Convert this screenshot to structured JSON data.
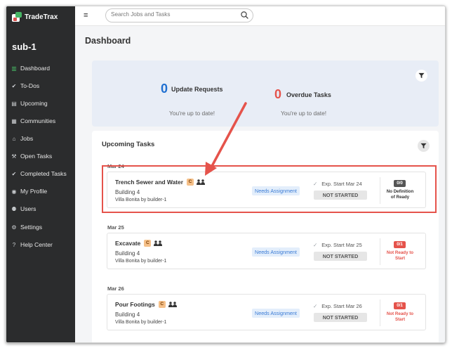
{
  "app": {
    "name": "TradeTrax",
    "org": "sub-1"
  },
  "sidebar": {
    "items": [
      {
        "label": "Dashboard",
        "icon": "dashboard-icon",
        "glyph": "▥",
        "active": true
      },
      {
        "label": "To-Dos",
        "icon": "check-circle-icon",
        "glyph": "✔"
      },
      {
        "label": "Upcoming",
        "icon": "clipboard-icon",
        "glyph": "▤"
      },
      {
        "label": "Communities",
        "icon": "building-icon",
        "glyph": "▦"
      },
      {
        "label": "Jobs",
        "icon": "home-icon",
        "glyph": "⌂"
      },
      {
        "label": "Open Tasks",
        "icon": "wrench-icon",
        "glyph": "⚒"
      },
      {
        "label": "Completed Tasks",
        "icon": "check-circle-icon",
        "glyph": "✔"
      },
      {
        "label": "My Profile",
        "icon": "user-circle-icon",
        "glyph": "◉"
      },
      {
        "label": "Users",
        "icon": "users-icon",
        "glyph": "⚉"
      },
      {
        "label": "Settings",
        "icon": "gear-icon",
        "glyph": "⚙"
      },
      {
        "label": "Help Center",
        "icon": "question-circle-icon",
        "glyph": "?"
      }
    ]
  },
  "header": {
    "search_placeholder": "Search Jobs and Tasks"
  },
  "page": {
    "title": "Dashboard"
  },
  "summary": {
    "update_requests": {
      "count": "0",
      "label": "Update Requests",
      "status": "You're up to date!"
    },
    "overdue_tasks": {
      "count": "0",
      "label": "Overdue Tasks",
      "status": "You're up to date!"
    }
  },
  "upcoming": {
    "title": "Upcoming Tasks",
    "groups": [
      {
        "date": "Mar 24",
        "task": {
          "name": "Trench Sewer and Water",
          "badge": "C",
          "building": "Building 4",
          "community": "Villa Bonita by builder-1",
          "assignment": "Needs Assignment",
          "exp_start": "Exp. Start Mar 24",
          "status": "NOT STARTED",
          "ready_badge": "0/0",
          "ready_text": "No Definition of Ready"
        }
      },
      {
        "date": "Mar 25",
        "task": {
          "name": "Excavate",
          "badge": "C",
          "building": "Building 4",
          "community": "Villa Bonita by builder-1",
          "assignment": "Needs Assignment",
          "exp_start": "Exp. Start Mar 25",
          "status": "NOT STARTED",
          "ready_badge": "0/1",
          "ready_text": "Not Ready to Start"
        }
      },
      {
        "date": "Mar 26",
        "task": {
          "name": "Pour Footings",
          "badge": "C",
          "building": "Building 4",
          "community": "Villa Bonita by builder-1",
          "assignment": "Needs Assignment",
          "exp_start": "Exp. Start Mar 26",
          "status": "NOT STARTED",
          "ready_badge": "0/1",
          "ready_text": "Not Ready to Start"
        }
      }
    ]
  },
  "colors": {
    "sidebar_bg": "#2b2c2d",
    "accent_blue": "#1f6fd1",
    "overdue_red": "#e5534b",
    "not_ready_red": "#e5534b",
    "no_def_grey": "#555555",
    "highlight_red": "#e5534b",
    "brand_green": "#47b564"
  }
}
